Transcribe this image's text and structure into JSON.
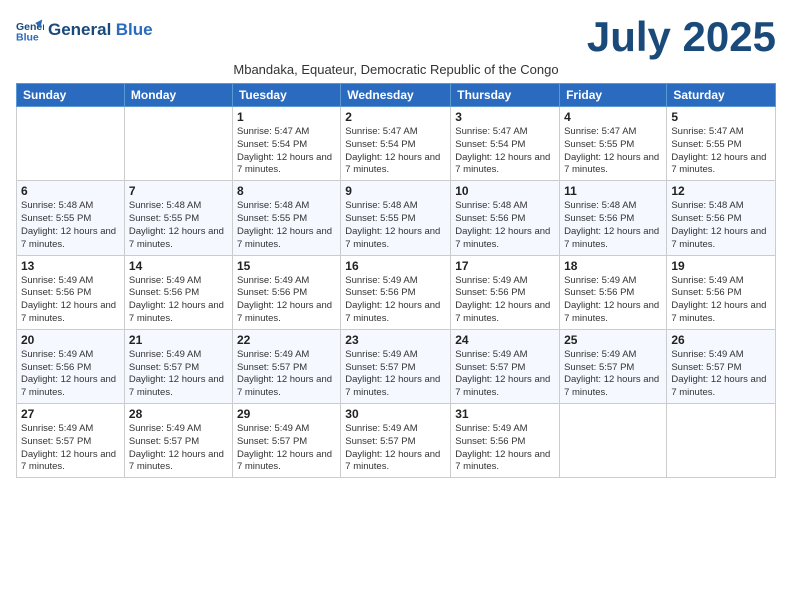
{
  "header": {
    "logo_line1": "General",
    "logo_line2": "Blue",
    "month": "July 2025",
    "subtitle": "Mbandaka, Equateur, Democratic Republic of the Congo"
  },
  "days_of_week": [
    "Sunday",
    "Monday",
    "Tuesday",
    "Wednesday",
    "Thursday",
    "Friday",
    "Saturday"
  ],
  "weeks": [
    [
      {
        "day": "",
        "info": ""
      },
      {
        "day": "",
        "info": ""
      },
      {
        "day": "1",
        "info": "Sunrise: 5:47 AM\nSunset: 5:54 PM\nDaylight: 12 hours and 7 minutes."
      },
      {
        "day": "2",
        "info": "Sunrise: 5:47 AM\nSunset: 5:54 PM\nDaylight: 12 hours and 7 minutes."
      },
      {
        "day": "3",
        "info": "Sunrise: 5:47 AM\nSunset: 5:54 PM\nDaylight: 12 hours and 7 minutes."
      },
      {
        "day": "4",
        "info": "Sunrise: 5:47 AM\nSunset: 5:55 PM\nDaylight: 12 hours and 7 minutes."
      },
      {
        "day": "5",
        "info": "Sunrise: 5:47 AM\nSunset: 5:55 PM\nDaylight: 12 hours and 7 minutes."
      }
    ],
    [
      {
        "day": "6",
        "info": "Sunrise: 5:48 AM\nSunset: 5:55 PM\nDaylight: 12 hours and 7 minutes."
      },
      {
        "day": "7",
        "info": "Sunrise: 5:48 AM\nSunset: 5:55 PM\nDaylight: 12 hours and 7 minutes."
      },
      {
        "day": "8",
        "info": "Sunrise: 5:48 AM\nSunset: 5:55 PM\nDaylight: 12 hours and 7 minutes."
      },
      {
        "day": "9",
        "info": "Sunrise: 5:48 AM\nSunset: 5:55 PM\nDaylight: 12 hours and 7 minutes."
      },
      {
        "day": "10",
        "info": "Sunrise: 5:48 AM\nSunset: 5:56 PM\nDaylight: 12 hours and 7 minutes."
      },
      {
        "day": "11",
        "info": "Sunrise: 5:48 AM\nSunset: 5:56 PM\nDaylight: 12 hours and 7 minutes."
      },
      {
        "day": "12",
        "info": "Sunrise: 5:48 AM\nSunset: 5:56 PM\nDaylight: 12 hours and 7 minutes."
      }
    ],
    [
      {
        "day": "13",
        "info": "Sunrise: 5:49 AM\nSunset: 5:56 PM\nDaylight: 12 hours and 7 minutes."
      },
      {
        "day": "14",
        "info": "Sunrise: 5:49 AM\nSunset: 5:56 PM\nDaylight: 12 hours and 7 minutes."
      },
      {
        "day": "15",
        "info": "Sunrise: 5:49 AM\nSunset: 5:56 PM\nDaylight: 12 hours and 7 minutes."
      },
      {
        "day": "16",
        "info": "Sunrise: 5:49 AM\nSunset: 5:56 PM\nDaylight: 12 hours and 7 minutes."
      },
      {
        "day": "17",
        "info": "Sunrise: 5:49 AM\nSunset: 5:56 PM\nDaylight: 12 hours and 7 minutes."
      },
      {
        "day": "18",
        "info": "Sunrise: 5:49 AM\nSunset: 5:56 PM\nDaylight: 12 hours and 7 minutes."
      },
      {
        "day": "19",
        "info": "Sunrise: 5:49 AM\nSunset: 5:56 PM\nDaylight: 12 hours and 7 minutes."
      }
    ],
    [
      {
        "day": "20",
        "info": "Sunrise: 5:49 AM\nSunset: 5:56 PM\nDaylight: 12 hours and 7 minutes."
      },
      {
        "day": "21",
        "info": "Sunrise: 5:49 AM\nSunset: 5:57 PM\nDaylight: 12 hours and 7 minutes."
      },
      {
        "day": "22",
        "info": "Sunrise: 5:49 AM\nSunset: 5:57 PM\nDaylight: 12 hours and 7 minutes."
      },
      {
        "day": "23",
        "info": "Sunrise: 5:49 AM\nSunset: 5:57 PM\nDaylight: 12 hours and 7 minutes."
      },
      {
        "day": "24",
        "info": "Sunrise: 5:49 AM\nSunset: 5:57 PM\nDaylight: 12 hours and 7 minutes."
      },
      {
        "day": "25",
        "info": "Sunrise: 5:49 AM\nSunset: 5:57 PM\nDaylight: 12 hours and 7 minutes."
      },
      {
        "day": "26",
        "info": "Sunrise: 5:49 AM\nSunset: 5:57 PM\nDaylight: 12 hours and 7 minutes."
      }
    ],
    [
      {
        "day": "27",
        "info": "Sunrise: 5:49 AM\nSunset: 5:57 PM\nDaylight: 12 hours and 7 minutes."
      },
      {
        "day": "28",
        "info": "Sunrise: 5:49 AM\nSunset: 5:57 PM\nDaylight: 12 hours and 7 minutes."
      },
      {
        "day": "29",
        "info": "Sunrise: 5:49 AM\nSunset: 5:57 PM\nDaylight: 12 hours and 7 minutes."
      },
      {
        "day": "30",
        "info": "Sunrise: 5:49 AM\nSunset: 5:57 PM\nDaylight: 12 hours and 7 minutes."
      },
      {
        "day": "31",
        "info": "Sunrise: 5:49 AM\nSunset: 5:56 PM\nDaylight: 12 hours and 7 minutes."
      },
      {
        "day": "",
        "info": ""
      },
      {
        "day": "",
        "info": ""
      }
    ]
  ]
}
